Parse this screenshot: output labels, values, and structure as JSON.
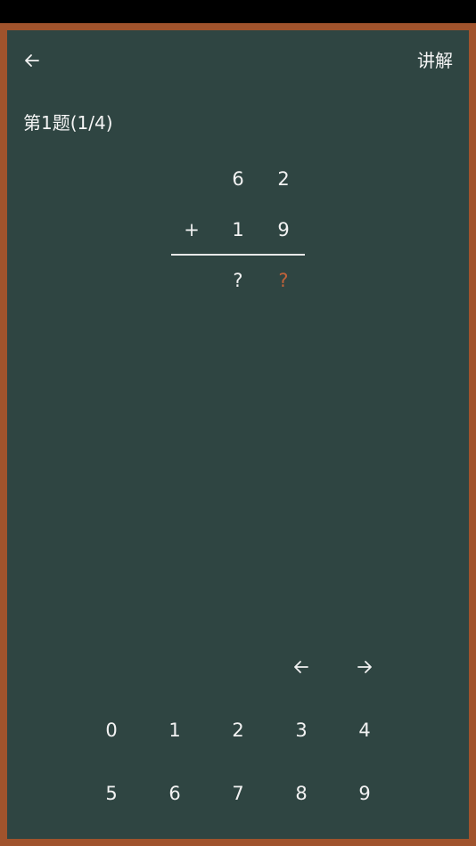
{
  "header": {
    "back_icon": "arrow-left-icon",
    "explain_label": "讲解"
  },
  "question": {
    "title": "第1题(1/4)"
  },
  "problem": {
    "row1": [
      "6",
      "2"
    ],
    "operator": "+",
    "row2": [
      "1",
      "9"
    ],
    "answer": [
      "?",
      "?"
    ],
    "active_answer_index": 1,
    "active_color": "#c0623a"
  },
  "keypad": {
    "nav": {
      "left_icon": "arrow-left-icon",
      "right_icon": "arrow-right-icon"
    },
    "row1": [
      "0",
      "1",
      "2",
      "3",
      "4"
    ],
    "row2": [
      "5",
      "6",
      "7",
      "8",
      "9"
    ]
  },
  "colors": {
    "board": "#2f4542",
    "frame": "#a0532c"
  }
}
